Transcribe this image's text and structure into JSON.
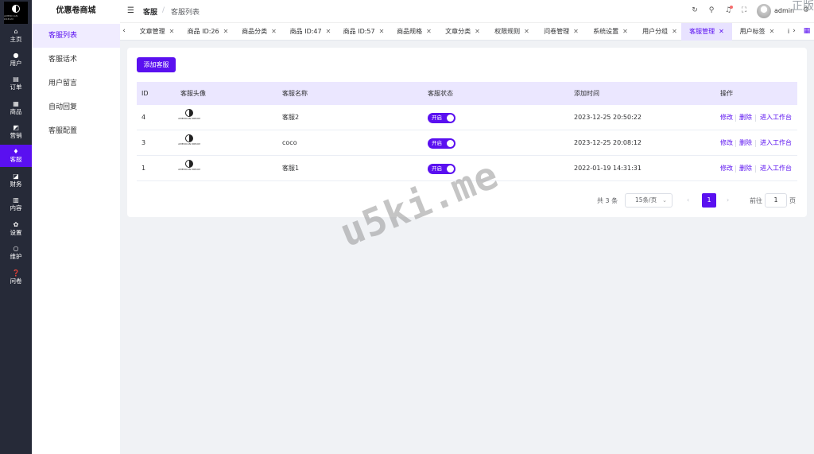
{
  "rail": {
    "logo_text": "AMERICAN DREAM",
    "items": [
      {
        "label": "主页",
        "icon": "home-icon",
        "glyph": "⌂"
      },
      {
        "label": "用户",
        "icon": "user-icon",
        "glyph": "●"
      },
      {
        "label": "订单",
        "icon": "order-icon",
        "glyph": "▤"
      },
      {
        "label": "商品",
        "icon": "goods-icon",
        "glyph": "▦"
      },
      {
        "label": "营销",
        "icon": "marketing-icon",
        "glyph": "◩"
      },
      {
        "label": "客服",
        "icon": "service-icon",
        "glyph": "♦"
      },
      {
        "label": "财务",
        "icon": "finance-icon",
        "glyph": "◪"
      },
      {
        "label": "内容",
        "icon": "content-icon",
        "glyph": "▥"
      },
      {
        "label": "设置",
        "icon": "settings-icon",
        "glyph": "✿"
      },
      {
        "label": "维护",
        "icon": "maintain-icon",
        "glyph": "○"
      },
      {
        "label": "问卷",
        "icon": "survey-icon",
        "glyph": "❓"
      }
    ],
    "active": "客服"
  },
  "submenu": {
    "title": "优惠卷商城",
    "items": [
      "客服列表",
      "客服话术",
      "用户留言",
      "自动回复",
      "客服配置"
    ],
    "active": "客服列表"
  },
  "header": {
    "breadcrumb_root": "客服",
    "breadcrumb_sep": "/",
    "breadcrumb_current": "客服列表",
    "user_name": "admin",
    "icons": [
      "refresh-icon",
      "search-icon",
      "notification-icon",
      "fullscreen-icon",
      "settings-icon"
    ]
  },
  "tabs": [
    {
      "label": "文章管理"
    },
    {
      "label": "商品 ID:26"
    },
    {
      "label": "商品分类"
    },
    {
      "label": "商品 ID:47"
    },
    {
      "label": "商品 ID:57"
    },
    {
      "label": "商品规格"
    },
    {
      "label": "文章分类"
    },
    {
      "label": "权限规则"
    },
    {
      "label": "问卷管理"
    },
    {
      "label": "系统设置"
    },
    {
      "label": "用户分组"
    },
    {
      "label": "客服管理",
      "active": true
    },
    {
      "label": "用户标签"
    },
    {
      "label": "i"
    }
  ],
  "main": {
    "add_button": "添加客服",
    "columns": [
      "ID",
      "客服头像",
      "客服名称",
      "客服状态",
      "添加时间",
      "操作"
    ],
    "avatar_text": "AMERICAN DREAM",
    "switch_label": "开启",
    "actions": [
      "修改",
      "删除",
      "进入工作台"
    ],
    "rows": [
      {
        "id": "4",
        "name": "客服2",
        "status": "开启",
        "time": "2023-12-25 20:50:22"
      },
      {
        "id": "3",
        "name": "coco",
        "status": "开启",
        "time": "2023-12-25 20:08:12"
      },
      {
        "id": "1",
        "name": "客服1",
        "status": "开启",
        "time": "2022-01-19 14:31:31"
      }
    ]
  },
  "pagination": {
    "total": "共 3 条",
    "page_size": "15条/页",
    "current_page": "1",
    "goto_label": "前往",
    "goto_value": "1",
    "goto_suffix": "页"
  },
  "watermark": "u5ki.me",
  "corner_text": "正版",
  "colors": {
    "accent": "#5a10f0",
    "rail": "#262a38",
    "table_header": "#ebe7ff"
  }
}
